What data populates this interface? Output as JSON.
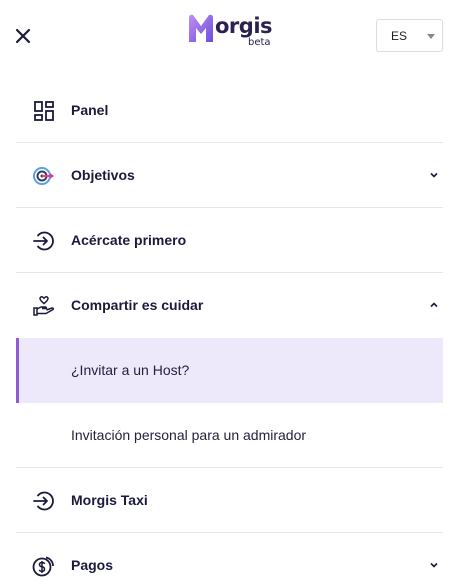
{
  "header": {
    "logo_text": "orgis",
    "logo_badge": "beta",
    "close_icon": "close-icon",
    "language": {
      "selected": "ES"
    }
  },
  "colors": {
    "brand_gradient_start": "#c08ef0",
    "brand_gradient_end": "#6a4fe0",
    "active_bg": "#ede9fb",
    "active_border": "#8a5cd6",
    "text_dark": "#1b1a3d"
  },
  "menu": {
    "items": [
      {
        "label": "Panel",
        "icon": "dashboard-icon"
      },
      {
        "label": "Objetivos",
        "icon": "target-icon",
        "chevron": "chevron-down"
      },
      {
        "label": "Acércate primero",
        "icon": "sign-in-icon"
      },
      {
        "label": "Compartir es cuidar",
        "icon": "hand-heart-icon",
        "chevron": "chevron-up",
        "subitems": [
          {
            "label": "¿Invitar a un Host?",
            "active": true
          },
          {
            "label": "Invitación personal para un admirador",
            "active": false
          }
        ]
      },
      {
        "label": "Morgis Taxi",
        "icon": "sign-in-icon"
      },
      {
        "label": "Pagos",
        "icon": "coin-dollar-icon",
        "chevron": "chevron-down"
      }
    ]
  }
}
